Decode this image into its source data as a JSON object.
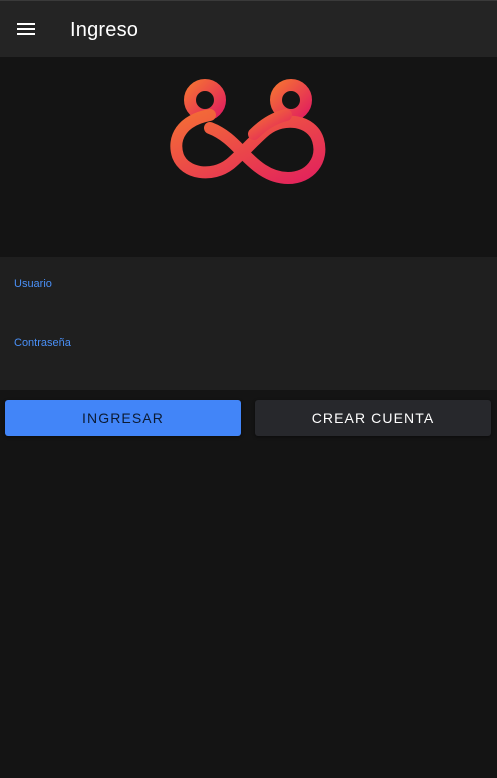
{
  "header": {
    "title": "Ingreso",
    "menu_icon": "hamburger-menu-icon"
  },
  "logo": {
    "icon": "infinity-88-logo",
    "gradient_start": "#f36a3a",
    "gradient_end": "#e3245a"
  },
  "form": {
    "username_label": "Usuario",
    "username_value": "",
    "password_label": "Contraseña",
    "password_value": ""
  },
  "actions": {
    "login_label": "INGRESAR",
    "create_account_label": "CREAR CUENTA"
  },
  "colors": {
    "background": "#141414",
    "appbar": "#242424",
    "form_background": "#1f1f1f",
    "accent": "#4285f8",
    "label": "#4a90f7"
  }
}
